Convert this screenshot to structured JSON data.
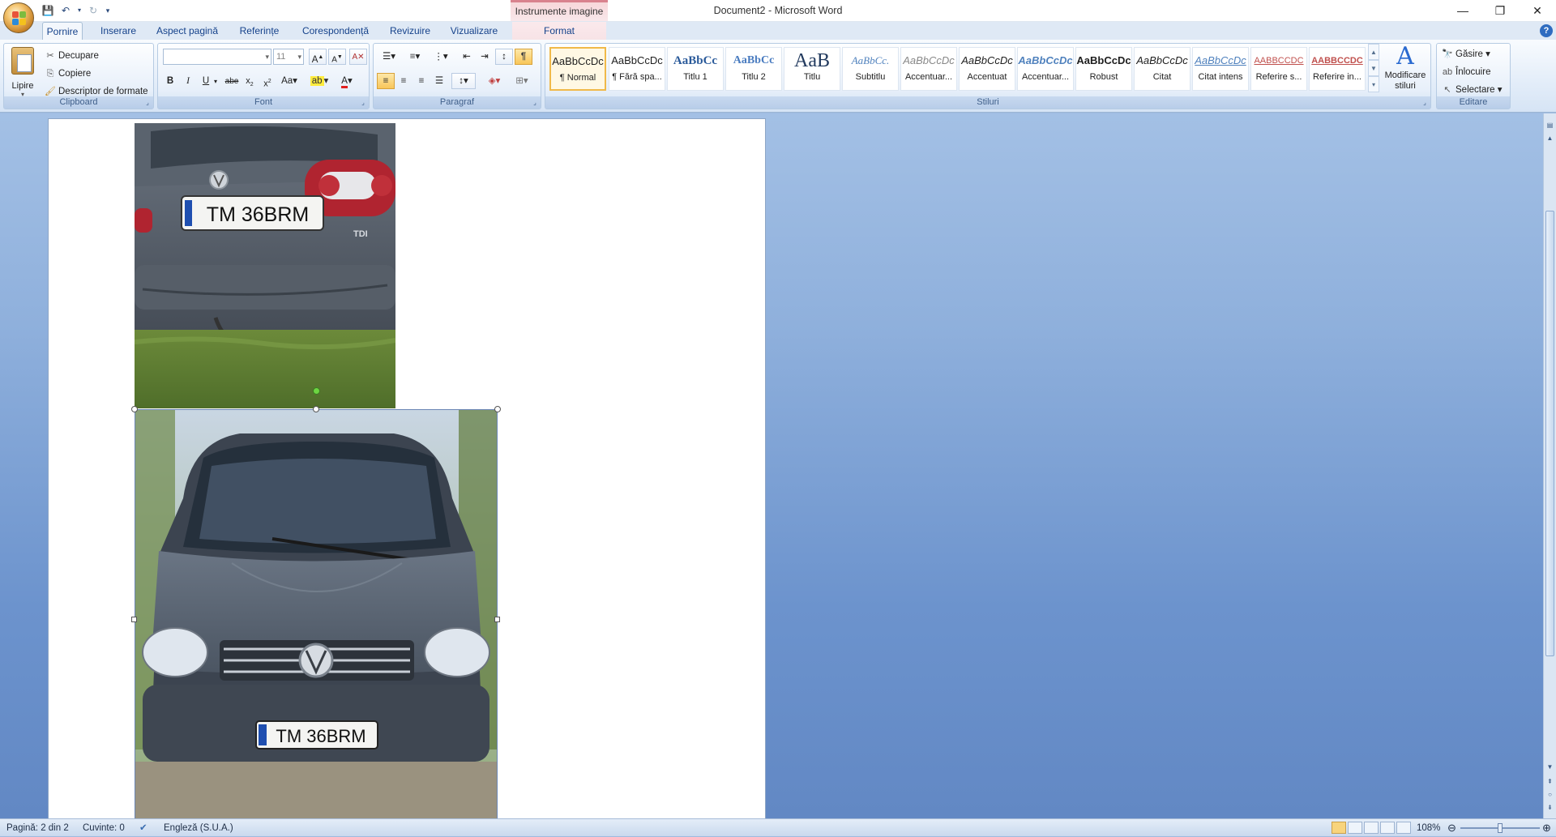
{
  "window": {
    "title": "Document2 - Microsoft Word",
    "context_tab": "Instrumente imagine"
  },
  "tabs": [
    "Pornire",
    "Inserare",
    "Aspect pagină",
    "Referințe",
    "Corespondență",
    "Revizuire",
    "Vizualizare",
    "Format"
  ],
  "active_tab": "Pornire",
  "clipboard": {
    "paste": "Lipire",
    "cut": "Decupare",
    "copy": "Copiere",
    "format_painter": "Descriptor de formate",
    "label": "Clipboard"
  },
  "font": {
    "name_value": "",
    "size_value": "11",
    "label": "Font"
  },
  "paragraph": {
    "label": "Paragraf"
  },
  "styles": {
    "label": "Stiluri",
    "items": [
      {
        "sample": "AaBbCcDc",
        "name": "¶ Normal"
      },
      {
        "sample": "AaBbCcDc",
        "name": "¶ Fără spa..."
      },
      {
        "sample": "AaBbCc",
        "name": "Titlu 1"
      },
      {
        "sample": "AaBbCc",
        "name": "Titlu 2"
      },
      {
        "sample": "AaB",
        "name": "Titlu"
      },
      {
        "sample": "AaBbCc.",
        "name": "Subtitlu"
      },
      {
        "sample": "AaBbCcDc",
        "name": "Accentuar..."
      },
      {
        "sample": "AaBbCcDc",
        "name": "Accentuat"
      },
      {
        "sample": "AaBbCcDc",
        "name": "Accentuar..."
      },
      {
        "sample": "AaBbCcDc",
        "name": "Robust"
      },
      {
        "sample": "AaBbCcDc",
        "name": "Citat"
      },
      {
        "sample": "AaBbCcDc",
        "name": "Citat intens"
      },
      {
        "sample": "AABBCCDC",
        "name": "Referire s..."
      },
      {
        "sample": "AABBCCDC",
        "name": "Referire in..."
      }
    ],
    "change_styles": "Modificare stiluri"
  },
  "editing": {
    "label": "Editare",
    "find": "Găsire",
    "replace": "Înlocuire",
    "select": "Selectare"
  },
  "document": {
    "image1_plate": "TM 36BRM",
    "image2_plate": "TM 36BRM"
  },
  "status": {
    "page": "Pagină: 2 din 2",
    "words": "Cuvinte: 0",
    "language": "Engleză (S.U.A.)",
    "zoom": "108%"
  },
  "colors": {
    "accent": "#15428b",
    "car": "#4e5866",
    "context": "#d9828e"
  }
}
